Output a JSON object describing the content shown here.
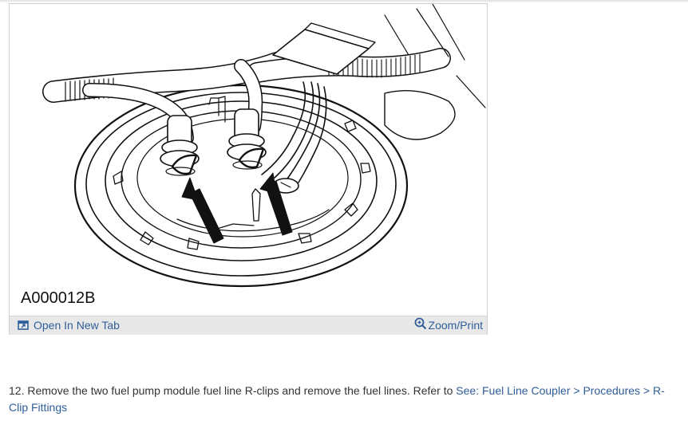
{
  "figure": {
    "code": "A000012B",
    "open_tab_label": "Open In New Tab",
    "zoom_label": "Zoom/Print",
    "icons": {
      "open_tab": "open-new-tab-icon",
      "zoom": "zoom-magnifier-icon"
    }
  },
  "step": {
    "text": "12. Remove the two fuel pump module fuel line R-clips and remove the fuel lines. Refer to ",
    "link_text": "See: Fuel Line Coupler > Procedures > R-Clip Fittings"
  },
  "colors": {
    "link": "#2f5e9b",
    "toolbar_bg": "#e8e8e8",
    "text": "#333333"
  }
}
